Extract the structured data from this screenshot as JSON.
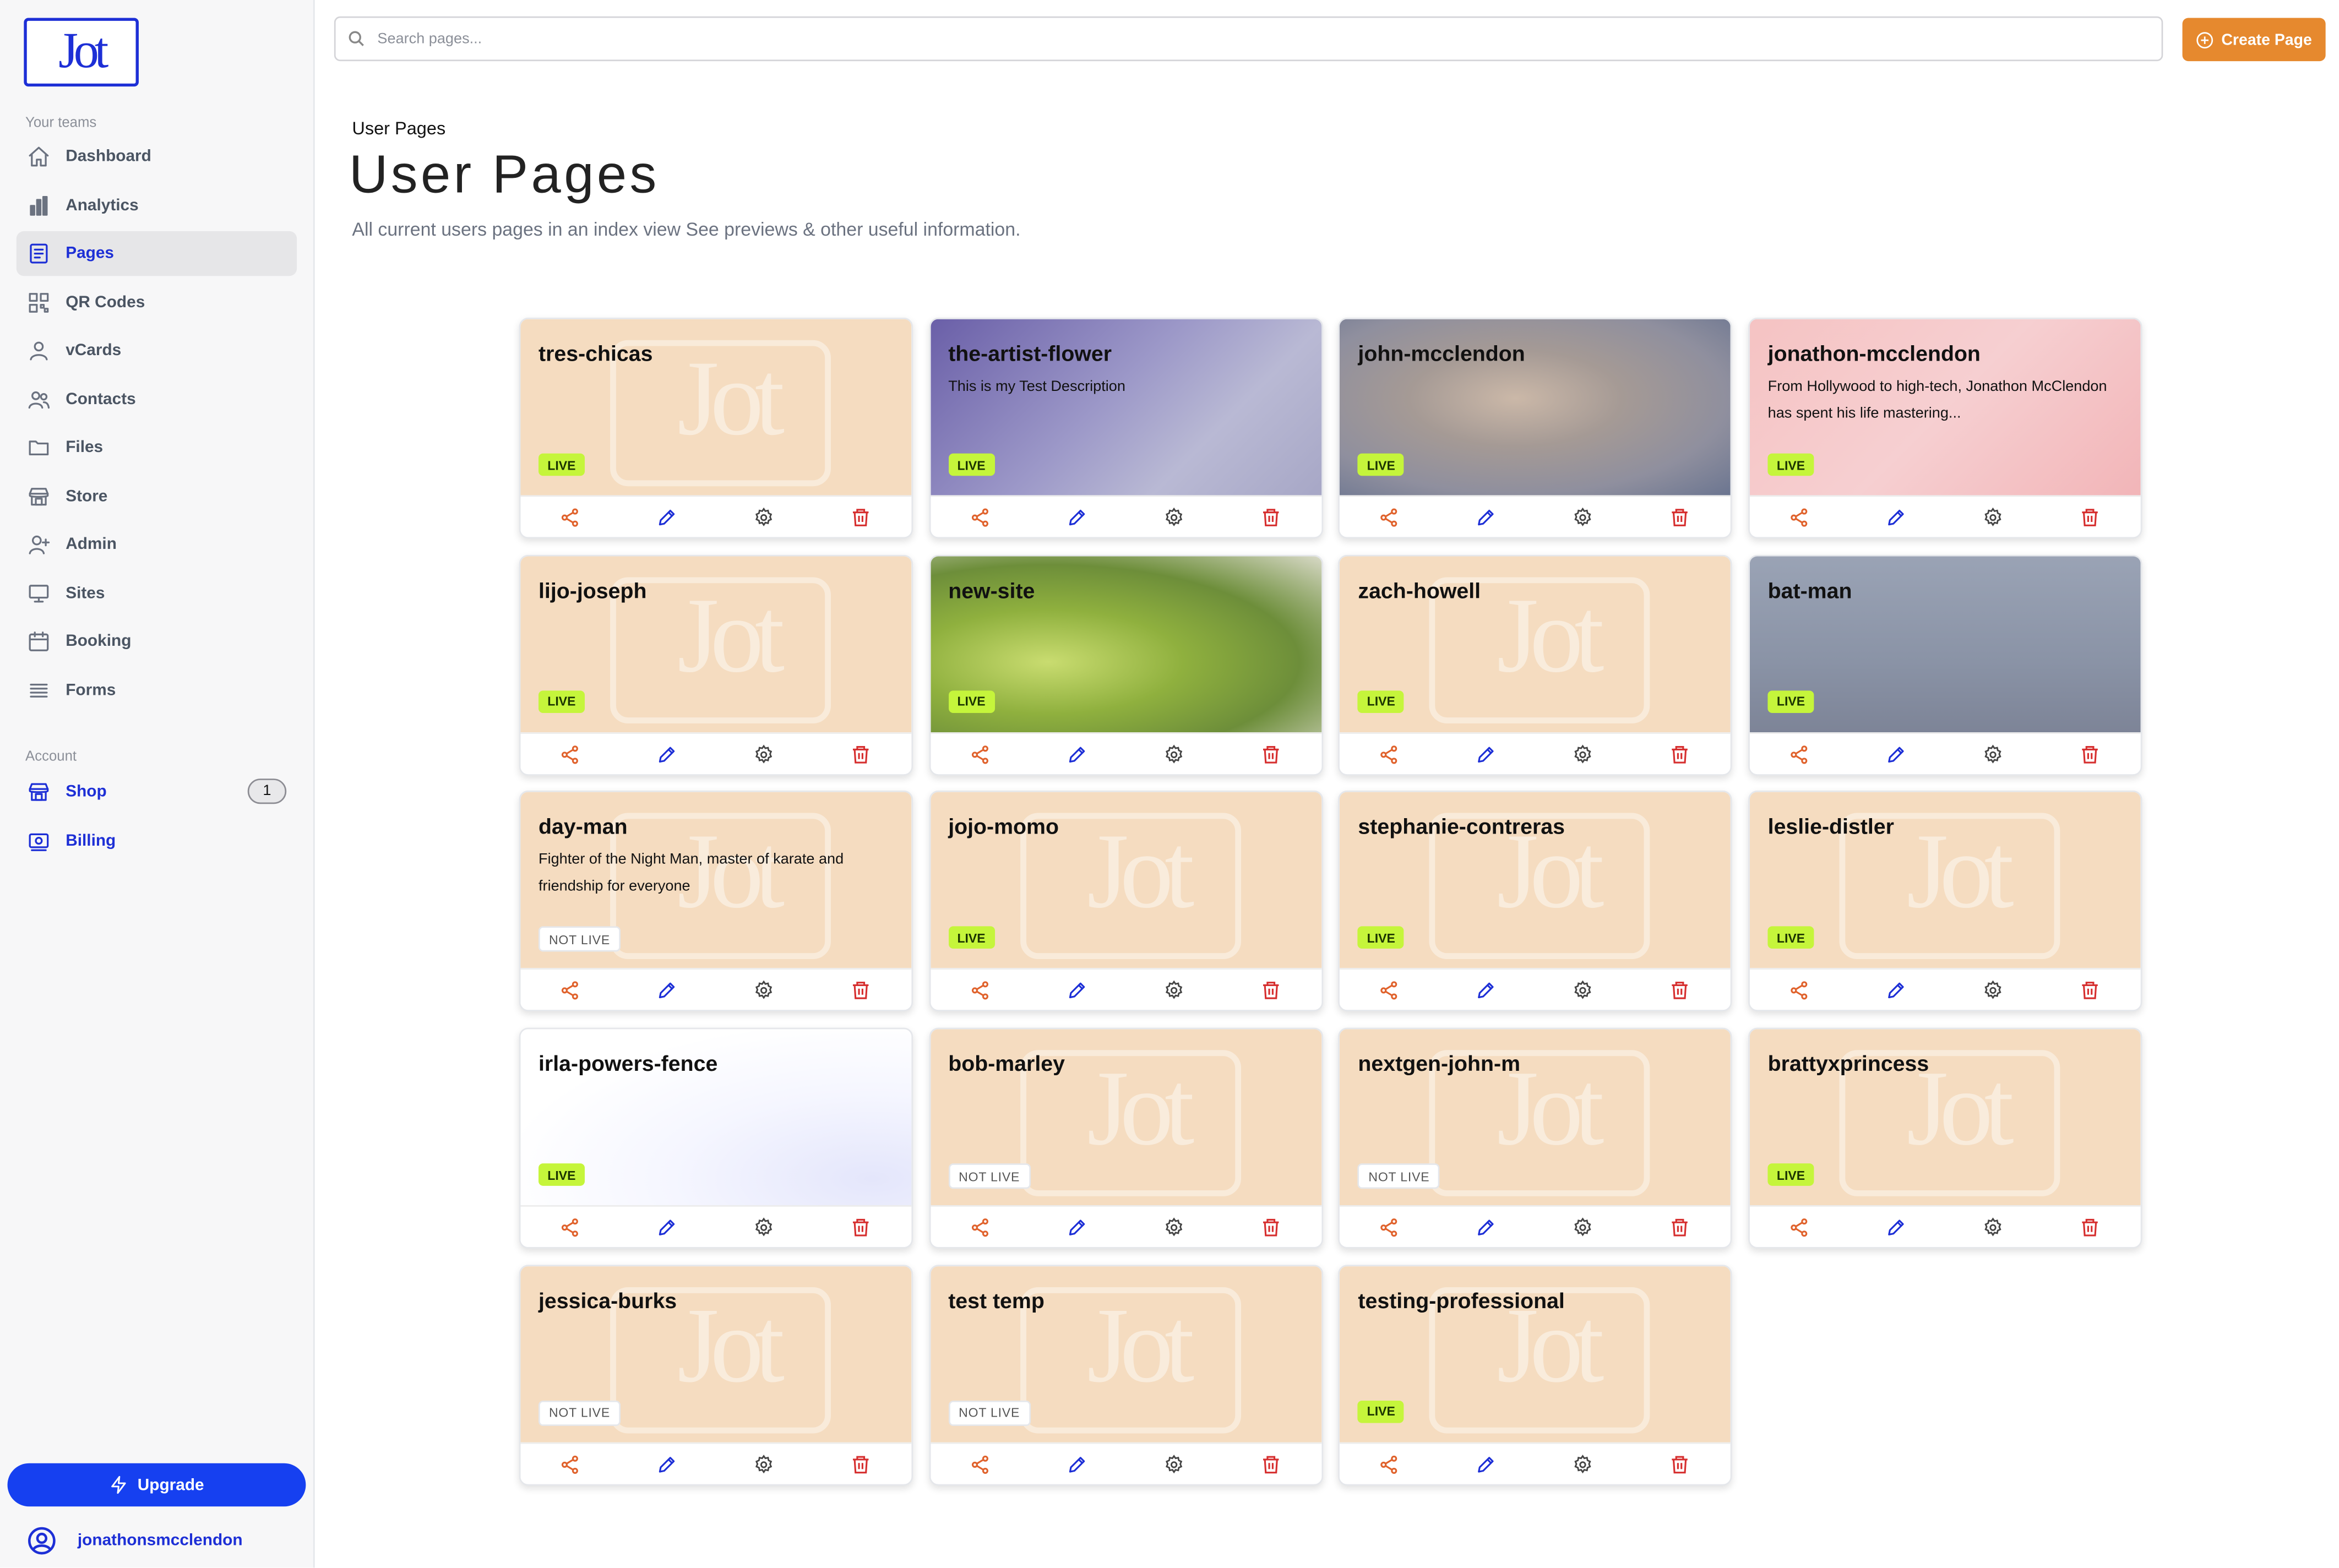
{
  "sidebar": {
    "logo_text": "Jot",
    "teams_label": "Your teams",
    "nav": [
      {
        "label": "Dashboard",
        "icon": "home-icon"
      },
      {
        "label": "Analytics",
        "icon": "bar-chart-icon"
      },
      {
        "label": "Pages",
        "icon": "pages-icon",
        "active": true
      },
      {
        "label": "QR Codes",
        "icon": "qr-code-icon"
      },
      {
        "label": "vCards",
        "icon": "user-icon"
      },
      {
        "label": "Contacts",
        "icon": "users-icon"
      },
      {
        "label": "Files",
        "icon": "folder-icon"
      },
      {
        "label": "Store",
        "icon": "store-icon"
      },
      {
        "label": "Admin",
        "icon": "user-plus-icon"
      },
      {
        "label": "Sites",
        "icon": "monitor-icon"
      },
      {
        "label": "Booking",
        "icon": "calendar-icon"
      },
      {
        "label": "Forms",
        "icon": "list-icon"
      }
    ],
    "account_label": "Account",
    "account": [
      {
        "label": "Shop",
        "icon": "shop-icon",
        "badge": "1"
      },
      {
        "label": "Billing",
        "icon": "billing-icon"
      }
    ],
    "upgrade_label": "Upgrade",
    "username": "jonathonsmcclendon"
  },
  "topbar": {
    "search_placeholder": "Search pages...",
    "create_label": "Create Page"
  },
  "header": {
    "breadcrumb": "User Pages",
    "title": "User Pages",
    "subtitle": "All current users pages in an index view See previews & other useful information."
  },
  "colors": {
    "accent_blue": "#1d2fd6",
    "upgrade_blue": "#1640f0",
    "create_orange": "#e6892e",
    "live_green": "#c5f53b",
    "card_peach": "#f5dcc0",
    "share_color": "#e0622c",
    "edit_color": "#1d2fd6",
    "settings_color": "#444444",
    "delete_color": "#d62f2f"
  },
  "cards": [
    {
      "name": "tres-chicas",
      "desc": "",
      "status": "LIVE",
      "bg": ""
    },
    {
      "name": "the-artist-flower",
      "desc": "This is my Test Description",
      "status": "LIVE",
      "bg": "bg-artist"
    },
    {
      "name": "john-mcclendon",
      "desc": "",
      "status": "LIVE",
      "bg": "bg-john"
    },
    {
      "name": "jonathon-mcclendon",
      "desc": "From Hollywood to high-tech, Jonathon McClendon has spent his life mastering...",
      "status": "LIVE",
      "bg": "bg-jonathon"
    },
    {
      "name": "lijo-joseph",
      "desc": "",
      "status": "LIVE",
      "bg": ""
    },
    {
      "name": "new-site",
      "desc": "",
      "status": "LIVE",
      "bg": "bg-newsite"
    },
    {
      "name": "zach-howell",
      "desc": "",
      "status": "LIVE",
      "bg": ""
    },
    {
      "name": "bat-man",
      "desc": "",
      "status": "LIVE",
      "bg": "bg-batman"
    },
    {
      "name": "day-man",
      "desc": "Fighter of the Night Man, master of karate and friendship for everyone",
      "status": "NOT LIVE",
      "bg": ""
    },
    {
      "name": "jojo-momo",
      "desc": "",
      "status": "LIVE",
      "bg": ""
    },
    {
      "name": "stephanie-contreras",
      "desc": "",
      "status": "LIVE",
      "bg": ""
    },
    {
      "name": "leslie-distler",
      "desc": "",
      "status": "LIVE",
      "bg": ""
    },
    {
      "name": "irla-powers-fence",
      "desc": "",
      "status": "LIVE",
      "bg": "bg-irla"
    },
    {
      "name": "bob-marley",
      "desc": "",
      "status": "NOT LIVE",
      "bg": ""
    },
    {
      "name": "nextgen-john-m",
      "desc": "",
      "status": "NOT LIVE",
      "bg": ""
    },
    {
      "name": "brattyxprincess",
      "desc": "",
      "status": "LIVE",
      "bg": ""
    },
    {
      "name": "jessica-burks",
      "desc": "",
      "status": "NOT LIVE",
      "bg": ""
    },
    {
      "name": "test temp",
      "desc": "",
      "status": "NOT LIVE",
      "bg": ""
    },
    {
      "name": "testing-professional",
      "desc": "",
      "status": "LIVE",
      "bg": ""
    }
  ]
}
